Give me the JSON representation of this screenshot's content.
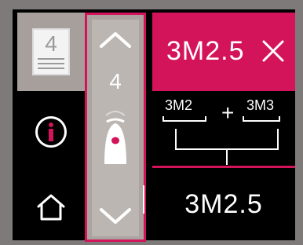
{
  "sidebar": {
    "page_number": "4",
    "items": [
      {
        "name": "page",
        "icon": "page-icon"
      },
      {
        "name": "info",
        "icon": "info-icon"
      },
      {
        "name": "home",
        "icon": "home-icon"
      }
    ]
  },
  "drum": {
    "value": "4",
    "up_icon": "chevron-up-icon",
    "down_icon": "chevron-down-icon",
    "bullet_icon": "bullet-icon"
  },
  "selection": {
    "label": "3M2.5",
    "clear_icon": "close-icon"
  },
  "combination": {
    "first": "3M2",
    "operator": "+",
    "second": "3M3"
  },
  "result": {
    "label": "3M2.5"
  },
  "colors": {
    "accent": "#d3145a",
    "panel_gray": "#a69f9b",
    "background": "#000000"
  }
}
